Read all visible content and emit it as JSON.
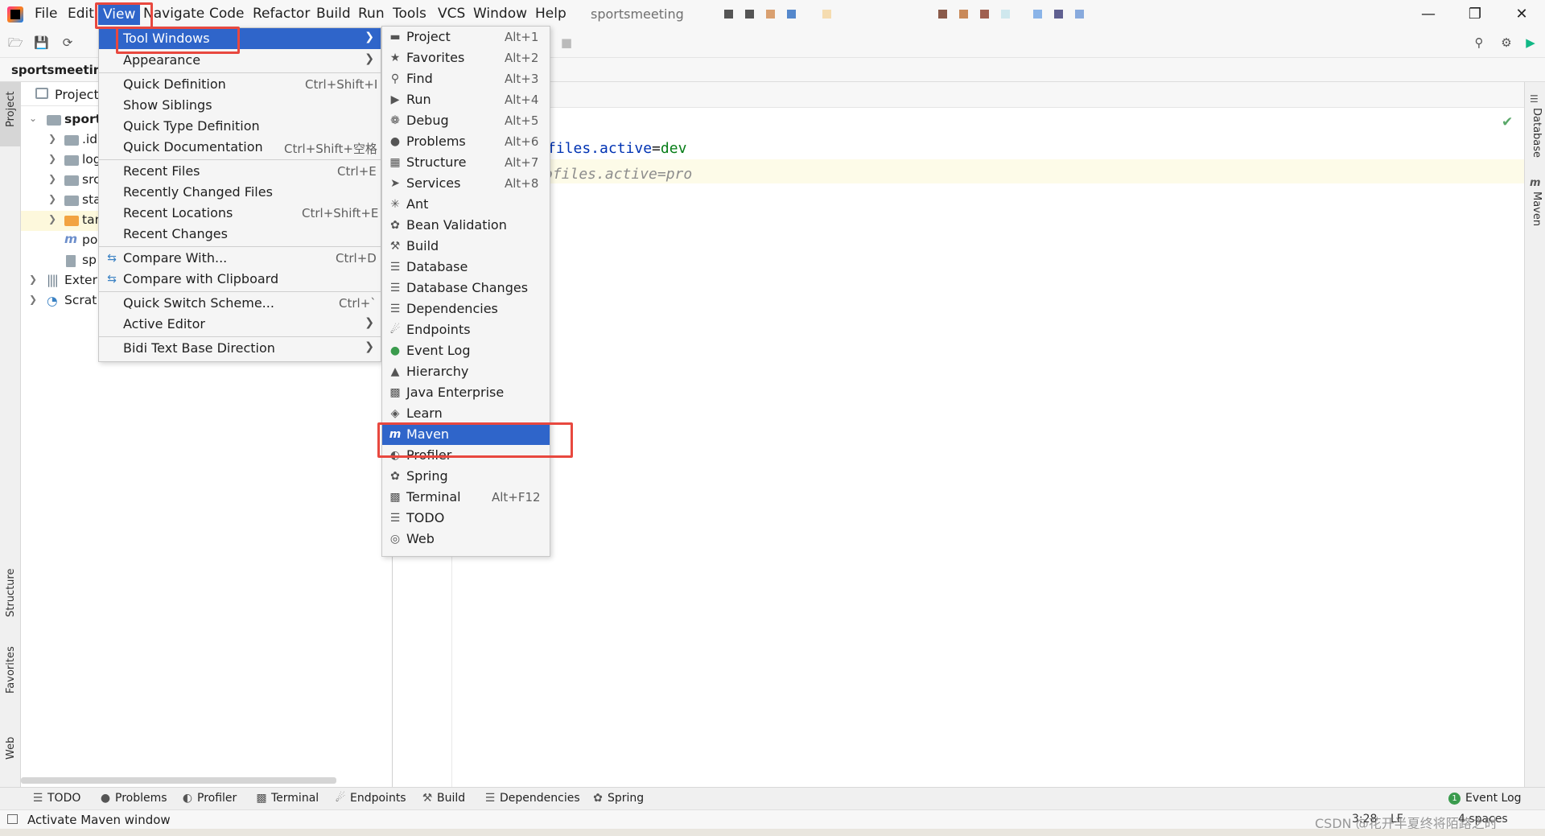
{
  "menubar": {
    "items": [
      "File",
      "Edit",
      "View",
      "Navigate",
      "Code",
      "Refactor",
      "Build",
      "Run",
      "Tools",
      "VCS",
      "Window",
      "Help"
    ],
    "project_title": "sportsmeeting"
  },
  "breadcrumb": {
    "project": "sportsmeeting"
  },
  "project_panel": {
    "title": "Project",
    "rows": [
      ".id",
      "log",
      "src",
      "sta",
      "tar",
      "po",
      "sp",
      "Exter",
      "Scrat"
    ],
    "root": "sport"
  },
  "editor": {
    "line1_key": "files.active",
    "line1_eq": "=",
    "line1_val": "dev",
    "line2_comment": "ofiles.active=pro"
  },
  "left_stripe": {
    "project": "Project",
    "structure": "Structure",
    "favorites": "Favorites",
    "web": "Web"
  },
  "right_stripe": {
    "database": "Database",
    "maven": "Maven"
  },
  "view_menu": {
    "items": [
      {
        "label": "Tool Windows",
        "shortcut": ""
      },
      {
        "label": "Appearance",
        "shortcut": ""
      },
      {
        "label": "Quick Definition",
        "shortcut": "Ctrl+Shift+I"
      },
      {
        "label": "Show Siblings",
        "shortcut": ""
      },
      {
        "label": "Quick Type Definition",
        "shortcut": ""
      },
      {
        "label": "Quick Documentation",
        "shortcut": "Ctrl+Shift+空格"
      },
      {
        "label": "Recent Files",
        "shortcut": "Ctrl+E"
      },
      {
        "label": "Recently Changed Files",
        "shortcut": ""
      },
      {
        "label": "Recent Locations",
        "shortcut": "Ctrl+Shift+E"
      },
      {
        "label": "Recent Changes",
        "shortcut": ""
      },
      {
        "label": "Compare With...",
        "shortcut": "Ctrl+D"
      },
      {
        "label": "Compare with Clipboard",
        "shortcut": ""
      },
      {
        "label": "Quick Switch Scheme...",
        "shortcut": "Ctrl+`"
      },
      {
        "label": "Active Editor",
        "shortcut": ""
      },
      {
        "label": "Bidi Text Base Direction",
        "shortcut": ""
      }
    ]
  },
  "tool_windows_menu": {
    "items": [
      {
        "label": "Project",
        "shortcut": "Alt+1",
        "icon": "folder-icon"
      },
      {
        "label": "Favorites",
        "shortcut": "Alt+2",
        "icon": "star-icon"
      },
      {
        "label": "Find",
        "shortcut": "Alt+3",
        "icon": "search-icon"
      },
      {
        "label": "Run",
        "shortcut": "Alt+4",
        "icon": "run-icon"
      },
      {
        "label": "Debug",
        "shortcut": "Alt+5",
        "icon": "bug-icon"
      },
      {
        "label": "Problems",
        "shortcut": "Alt+6",
        "icon": "problems-icon"
      },
      {
        "label": "Structure",
        "shortcut": "Alt+7",
        "icon": "structure-icon"
      },
      {
        "label": "Services",
        "shortcut": "Alt+8",
        "icon": "services-icon"
      },
      {
        "label": "Ant",
        "shortcut": "",
        "icon": "ant-icon"
      },
      {
        "label": "Bean Validation",
        "shortcut": "",
        "icon": "bean-validation-icon"
      },
      {
        "label": "Build",
        "shortcut": "",
        "icon": "hammer-icon"
      },
      {
        "label": "Database",
        "shortcut": "",
        "icon": "database-icon"
      },
      {
        "label": "Database Changes",
        "shortcut": "",
        "icon": "database-changes-icon"
      },
      {
        "label": "Dependencies",
        "shortcut": "",
        "icon": "dependencies-icon"
      },
      {
        "label": "Endpoints",
        "shortcut": "",
        "icon": "endpoints-icon"
      },
      {
        "label": "Event Log",
        "shortcut": "",
        "icon": "event-log-icon"
      },
      {
        "label": "Hierarchy",
        "shortcut": "",
        "icon": "hierarchy-icon"
      },
      {
        "label": "Java Enterprise",
        "shortcut": "",
        "icon": "java-enterprise-icon"
      },
      {
        "label": "Learn",
        "shortcut": "",
        "icon": "learn-icon"
      },
      {
        "label": "Maven",
        "shortcut": "",
        "icon": "maven-icon"
      },
      {
        "label": "Profiler",
        "shortcut": "",
        "icon": "profiler-icon"
      },
      {
        "label": "Spring",
        "shortcut": "",
        "icon": "spring-icon"
      },
      {
        "label": "Terminal",
        "shortcut": "Alt+F12",
        "icon": "terminal-icon"
      },
      {
        "label": "TODO",
        "shortcut": "",
        "icon": "todo-icon"
      },
      {
        "label": "Web",
        "shortcut": "",
        "icon": "web-icon"
      }
    ]
  },
  "bottom_bar": {
    "tabs": [
      "TODO",
      "Problems",
      "Profiler",
      "Terminal",
      "Endpoints",
      "Build",
      "Dependencies",
      "Spring"
    ],
    "event_log": "Event Log",
    "event_log_count": "1"
  },
  "status": {
    "message": "Activate Maven window",
    "position": "3:28",
    "line_sep": "LF",
    "indent": "4 spaces",
    "watermark": "CSDN @花开半夏终将陌路之时"
  },
  "colors": {
    "selection": "#2f65ca",
    "highlight_box": "#e8483f",
    "accent": "#087cfa"
  }
}
